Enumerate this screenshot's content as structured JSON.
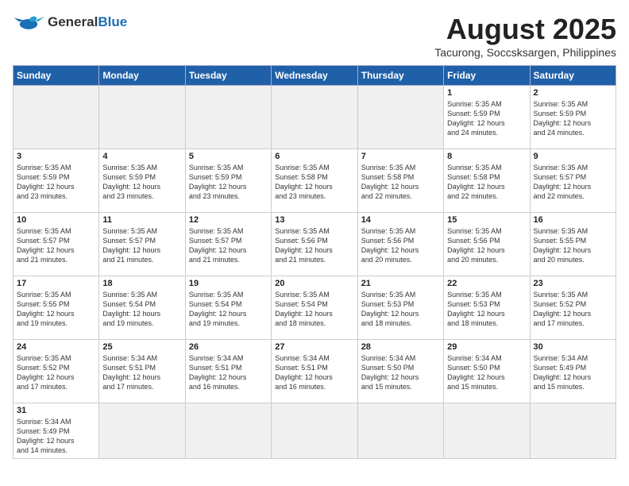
{
  "header": {
    "logo_general": "General",
    "logo_blue": "Blue",
    "month_year": "August 2025",
    "location": "Tacurong, Soccsksargen, Philippines"
  },
  "weekdays": [
    "Sunday",
    "Monday",
    "Tuesday",
    "Wednesday",
    "Thursday",
    "Friday",
    "Saturday"
  ],
  "weeks": [
    [
      {
        "day": "",
        "info": ""
      },
      {
        "day": "",
        "info": ""
      },
      {
        "day": "",
        "info": ""
      },
      {
        "day": "",
        "info": ""
      },
      {
        "day": "",
        "info": ""
      },
      {
        "day": "1",
        "info": "Sunrise: 5:35 AM\nSunset: 5:59 PM\nDaylight: 12 hours\nand 24 minutes."
      },
      {
        "day": "2",
        "info": "Sunrise: 5:35 AM\nSunset: 5:59 PM\nDaylight: 12 hours\nand 24 minutes."
      }
    ],
    [
      {
        "day": "3",
        "info": "Sunrise: 5:35 AM\nSunset: 5:59 PM\nDaylight: 12 hours\nand 23 minutes."
      },
      {
        "day": "4",
        "info": "Sunrise: 5:35 AM\nSunset: 5:59 PM\nDaylight: 12 hours\nand 23 minutes."
      },
      {
        "day": "5",
        "info": "Sunrise: 5:35 AM\nSunset: 5:59 PM\nDaylight: 12 hours\nand 23 minutes."
      },
      {
        "day": "6",
        "info": "Sunrise: 5:35 AM\nSunset: 5:58 PM\nDaylight: 12 hours\nand 23 minutes."
      },
      {
        "day": "7",
        "info": "Sunrise: 5:35 AM\nSunset: 5:58 PM\nDaylight: 12 hours\nand 22 minutes."
      },
      {
        "day": "8",
        "info": "Sunrise: 5:35 AM\nSunset: 5:58 PM\nDaylight: 12 hours\nand 22 minutes."
      },
      {
        "day": "9",
        "info": "Sunrise: 5:35 AM\nSunset: 5:57 PM\nDaylight: 12 hours\nand 22 minutes."
      }
    ],
    [
      {
        "day": "10",
        "info": "Sunrise: 5:35 AM\nSunset: 5:57 PM\nDaylight: 12 hours\nand 21 minutes."
      },
      {
        "day": "11",
        "info": "Sunrise: 5:35 AM\nSunset: 5:57 PM\nDaylight: 12 hours\nand 21 minutes."
      },
      {
        "day": "12",
        "info": "Sunrise: 5:35 AM\nSunset: 5:57 PM\nDaylight: 12 hours\nand 21 minutes."
      },
      {
        "day": "13",
        "info": "Sunrise: 5:35 AM\nSunset: 5:56 PM\nDaylight: 12 hours\nand 21 minutes."
      },
      {
        "day": "14",
        "info": "Sunrise: 5:35 AM\nSunset: 5:56 PM\nDaylight: 12 hours\nand 20 minutes."
      },
      {
        "day": "15",
        "info": "Sunrise: 5:35 AM\nSunset: 5:56 PM\nDaylight: 12 hours\nand 20 minutes."
      },
      {
        "day": "16",
        "info": "Sunrise: 5:35 AM\nSunset: 5:55 PM\nDaylight: 12 hours\nand 20 minutes."
      }
    ],
    [
      {
        "day": "17",
        "info": "Sunrise: 5:35 AM\nSunset: 5:55 PM\nDaylight: 12 hours\nand 19 minutes."
      },
      {
        "day": "18",
        "info": "Sunrise: 5:35 AM\nSunset: 5:54 PM\nDaylight: 12 hours\nand 19 minutes."
      },
      {
        "day": "19",
        "info": "Sunrise: 5:35 AM\nSunset: 5:54 PM\nDaylight: 12 hours\nand 19 minutes."
      },
      {
        "day": "20",
        "info": "Sunrise: 5:35 AM\nSunset: 5:54 PM\nDaylight: 12 hours\nand 18 minutes."
      },
      {
        "day": "21",
        "info": "Sunrise: 5:35 AM\nSunset: 5:53 PM\nDaylight: 12 hours\nand 18 minutes."
      },
      {
        "day": "22",
        "info": "Sunrise: 5:35 AM\nSunset: 5:53 PM\nDaylight: 12 hours\nand 18 minutes."
      },
      {
        "day": "23",
        "info": "Sunrise: 5:35 AM\nSunset: 5:52 PM\nDaylight: 12 hours\nand 17 minutes."
      }
    ],
    [
      {
        "day": "24",
        "info": "Sunrise: 5:35 AM\nSunset: 5:52 PM\nDaylight: 12 hours\nand 17 minutes."
      },
      {
        "day": "25",
        "info": "Sunrise: 5:34 AM\nSunset: 5:51 PM\nDaylight: 12 hours\nand 17 minutes."
      },
      {
        "day": "26",
        "info": "Sunrise: 5:34 AM\nSunset: 5:51 PM\nDaylight: 12 hours\nand 16 minutes."
      },
      {
        "day": "27",
        "info": "Sunrise: 5:34 AM\nSunset: 5:51 PM\nDaylight: 12 hours\nand 16 minutes."
      },
      {
        "day": "28",
        "info": "Sunrise: 5:34 AM\nSunset: 5:50 PM\nDaylight: 12 hours\nand 15 minutes."
      },
      {
        "day": "29",
        "info": "Sunrise: 5:34 AM\nSunset: 5:50 PM\nDaylight: 12 hours\nand 15 minutes."
      },
      {
        "day": "30",
        "info": "Sunrise: 5:34 AM\nSunset: 5:49 PM\nDaylight: 12 hours\nand 15 minutes."
      }
    ],
    [
      {
        "day": "31",
        "info": "Sunrise: 5:34 AM\nSunset: 5:49 PM\nDaylight: 12 hours\nand 14 minutes."
      },
      {
        "day": "",
        "info": ""
      },
      {
        "day": "",
        "info": ""
      },
      {
        "day": "",
        "info": ""
      },
      {
        "day": "",
        "info": ""
      },
      {
        "day": "",
        "info": ""
      },
      {
        "day": "",
        "info": ""
      }
    ]
  ]
}
